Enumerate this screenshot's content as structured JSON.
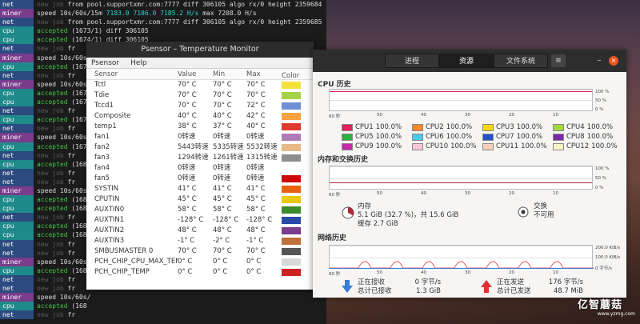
{
  "terminal": {
    "rows": [
      {
        "tag": "net",
        "parts": [
          [
            "new",
            "new job"
          ],
          [
            "txt",
            " from pool.supportxmr.com:7777 diff 306105 algo rx/0 height 2359684"
          ]
        ]
      },
      {
        "tag": "miner",
        "parts": [
          [
            "speed",
            "speed 10s/60s/15m "
          ],
          [
            "num",
            "7183.0 7186.0 7185.2 H/s"
          ],
          [
            "txt",
            " max 7208.0 H/s"
          ]
        ]
      },
      {
        "tag": "net",
        "parts": [
          [
            "new",
            "new job"
          ],
          [
            "txt",
            " from pool.supportxmr.com:7777 diff 306105 algo rx/0 height 2359685"
          ]
        ]
      },
      {
        "tag": "cpu",
        "parts": [
          [
            "acc",
            "accepted"
          ],
          [
            "txt",
            " (1673/1) diff 306105"
          ]
        ]
      },
      {
        "tag": "cpu",
        "parts": [
          [
            "acc",
            "accepted"
          ],
          [
            "txt",
            " (1674/1) diff 306105"
          ]
        ]
      },
      {
        "tag": "net",
        "parts": [
          [
            "new",
            "new job"
          ],
          [
            "txt",
            " fr"
          ]
        ]
      },
      {
        "tag": "miner",
        "parts": [
          [
            "speed",
            "speed 10s/60s/"
          ]
        ]
      },
      {
        "tag": "cpu",
        "parts": [
          [
            "acc",
            "accepted"
          ],
          [
            "txt",
            " (167"
          ]
        ]
      },
      {
        "tag": "net",
        "parts": [
          [
            "new",
            "new job"
          ],
          [
            "txt",
            " fr"
          ]
        ]
      },
      {
        "tag": "miner",
        "parts": [
          [
            "speed",
            "speed 10s/60s/"
          ]
        ]
      },
      {
        "tag": "cpu",
        "parts": [
          [
            "acc",
            "accepted"
          ],
          [
            "txt",
            " (167"
          ]
        ]
      },
      {
        "tag": "cpu",
        "parts": [
          [
            "acc",
            "accepted"
          ],
          [
            "txt",
            " (167"
          ]
        ]
      },
      {
        "tag": "net",
        "parts": [
          [
            "new",
            "new job"
          ],
          [
            "txt",
            " fr"
          ]
        ]
      },
      {
        "tag": "cpu",
        "parts": [
          [
            "acc",
            "accepted"
          ],
          [
            "txt",
            " (167"
          ]
        ]
      },
      {
        "tag": "net",
        "parts": [
          [
            "new",
            "new job"
          ],
          [
            "txt",
            " fr"
          ]
        ]
      },
      {
        "tag": "miner",
        "parts": [
          [
            "speed",
            "speed 10s/60s/"
          ]
        ]
      },
      {
        "tag": "cpu",
        "parts": [
          [
            "acc",
            "accepted"
          ],
          [
            "txt",
            " (167"
          ]
        ]
      },
      {
        "tag": "net",
        "parts": [
          [
            "new",
            "new job"
          ],
          [
            "txt",
            " fr"
          ]
        ]
      },
      {
        "tag": "cpu",
        "parts": [
          [
            "acc",
            "accepted"
          ],
          [
            "txt",
            " (168"
          ]
        ]
      },
      {
        "tag": "net",
        "parts": [
          [
            "new",
            "new job"
          ],
          [
            "txt",
            " fr"
          ]
        ]
      },
      {
        "tag": "net",
        "parts": [
          [
            "new",
            "new job"
          ],
          [
            "txt",
            " fr"
          ]
        ]
      },
      {
        "tag": "miner",
        "parts": [
          [
            "speed",
            "speed 10s/60s/"
          ]
        ]
      },
      {
        "tag": "cpu",
        "parts": [
          [
            "acc",
            "accepted"
          ],
          [
            "txt",
            " (168"
          ]
        ]
      },
      {
        "tag": "cpu",
        "parts": [
          [
            "acc",
            "accepted"
          ],
          [
            "txt",
            " (168"
          ]
        ]
      },
      {
        "tag": "net",
        "parts": [
          [
            "new",
            "new job"
          ],
          [
            "txt",
            " fr"
          ]
        ]
      },
      {
        "tag": "cpu",
        "parts": [
          [
            "acc",
            "accepted"
          ],
          [
            "txt",
            " (168"
          ]
        ]
      },
      {
        "tag": "cpu",
        "parts": [
          [
            "acc",
            "accepted"
          ],
          [
            "txt",
            " (168"
          ]
        ]
      },
      {
        "tag": "net",
        "parts": [
          [
            "new",
            "new job"
          ],
          [
            "txt",
            " fr"
          ]
        ]
      },
      {
        "tag": "net",
        "parts": [
          [
            "new",
            "new job"
          ],
          [
            "txt",
            " fr"
          ]
        ]
      },
      {
        "tag": "miner",
        "parts": [
          [
            "speed",
            "speed 10s/60s/"
          ]
        ]
      },
      {
        "tag": "cpu",
        "parts": [
          [
            "acc",
            "accepted"
          ],
          [
            "txt",
            " (168"
          ]
        ]
      },
      {
        "tag": "net",
        "parts": [
          [
            "new",
            "new job"
          ],
          [
            "txt",
            " fr"
          ]
        ]
      },
      {
        "tag": "net",
        "parts": [
          [
            "new",
            "new job"
          ],
          [
            "txt",
            " fr"
          ]
        ]
      },
      {
        "tag": "miner",
        "parts": [
          [
            "speed",
            "speed 10s/60s/"
          ]
        ]
      },
      {
        "tag": "cpu",
        "parts": [
          [
            "acc",
            "accepted"
          ],
          [
            "txt",
            " (168"
          ]
        ]
      },
      {
        "tag": "net",
        "parts": [
          [
            "new",
            "new job"
          ],
          [
            "txt",
            " fr"
          ]
        ]
      }
    ]
  },
  "psensor": {
    "title": "Psensor – Temperature Monitor",
    "menu": [
      "Psensor",
      "Help"
    ],
    "headers": {
      "sensor": "Sensor",
      "value": "Value",
      "min": "Min",
      "max": "Max",
      "color": "Color"
    },
    "rows": [
      {
        "name": "Tctl",
        "value": "70° C",
        "min": "70° C",
        "max": "70° C",
        "color": "#f5e13c",
        "checked": false
      },
      {
        "name": "Tdie",
        "value": "70° C",
        "min": "70° C",
        "max": "70° C",
        "color": "#a6d24a",
        "checked": false
      },
      {
        "name": "Tccd1",
        "value": "70° C",
        "min": "70° C",
        "max": "72° C",
        "color": "#6f8fd4",
        "checked": false
      },
      {
        "name": "Composite",
        "value": "40° C",
        "min": "40° C",
        "max": "42° C",
        "color": "#f7a340",
        "checked": false
      },
      {
        "name": "temp1",
        "value": "38° C",
        "min": "37° C",
        "max": "40° C",
        "color": "#e03a2e",
        "checked": false
      },
      {
        "name": "fan1",
        "value": "0转速",
        "min": "0转速",
        "max": "0转速",
        "color": "#b07ab8",
        "checked": false
      },
      {
        "name": "fan2",
        "value": "5443转速",
        "min": "5335转速",
        "max": "5532转速",
        "color": "#e8b888",
        "checked": false
      },
      {
        "name": "fan3",
        "value": "1294转速",
        "min": "1261转速",
        "max": "1315转速",
        "color": "#8e8e8e",
        "checked": false
      },
      {
        "name": "fan4",
        "value": "0转速",
        "min": "0转速",
        "max": "0转速",
        "color": "#ffffff",
        "checked": false
      },
      {
        "name": "fan5",
        "value": "0转速",
        "min": "0转速",
        "max": "0转速",
        "color": "#cc0a0a",
        "checked": false
      },
      {
        "name": "SYSTIN",
        "value": "41° C",
        "min": "41° C",
        "max": "41° C",
        "color": "#e8610e",
        "checked": false
      },
      {
        "name": "CPUTIN",
        "value": "45° C",
        "min": "45° C",
        "max": "45° C",
        "color": "#e8c810",
        "checked": false
      },
      {
        "name": "AUXTIN0",
        "value": "58° C",
        "min": "58° C",
        "max": "58° C",
        "color": "#3c8a2a",
        "checked": false
      },
      {
        "name": "AUXTIN1",
        "value": "-128° C",
        "min": "-128° C",
        "max": "-128° C",
        "color": "#2a4aa8",
        "checked": false
      },
      {
        "name": "AUXTIN2",
        "value": "48° C",
        "min": "48° C",
        "max": "48° C",
        "color": "#7a3c8c",
        "checked": false
      },
      {
        "name": "AUXTIN3",
        "value": "-1° C",
        "min": "-2° C",
        "max": "-1° C",
        "color": "#c0703a",
        "checked": false
      },
      {
        "name": "SMBUSMASTER 0",
        "value": "70° C",
        "min": "70° C",
        "max": "70° C",
        "color": "#555555",
        "checked": false
      },
      {
        "name": "PCH_CHIP_CPU_MAX_TEMP",
        "value": "0° C",
        "min": "0° C",
        "max": "0° C",
        "color": "#d8d8d8",
        "checked": false
      },
      {
        "name": "PCH_CHIP_TEMP",
        "value": "0° C",
        "min": "0° C",
        "max": "0° C",
        "color": "#cc2222",
        "checked": false
      }
    ]
  },
  "sysmon": {
    "tabs": [
      "进程",
      "资源",
      "文件系统"
    ],
    "active_tab": 1,
    "menu_icon": "hamburger-icon",
    "minimize": "–",
    "close": "×",
    "cpu": {
      "title": "CPU 历史",
      "y_top": "100 %",
      "y_mid": "50 %",
      "y_bottom": "0 %",
      "x_label": "60 秒",
      "x_ticks": [
        "50",
        "40",
        "30",
        "20",
        "10"
      ],
      "cores": [
        {
          "label": "CPU1",
          "value": "100.0%",
          "color": "#e5205a"
        },
        {
          "label": "CPU2",
          "value": "100.0%",
          "color": "#f7892a"
        },
        {
          "label": "CPU3",
          "value": "100.0%",
          "color": "#f5d90a"
        },
        {
          "label": "CPU4",
          "value": "100.0%",
          "color": "#a4d83a"
        },
        {
          "label": "CPU5",
          "value": "100.0%",
          "color": "#2cb040"
        },
        {
          "label": "CPU6",
          "value": "100.0%",
          "color": "#4ac8ea"
        },
        {
          "label": "CPU7",
          "value": "100.0%",
          "color": "#2a50c8"
        },
        {
          "label": "CPU8",
          "value": "100.0%",
          "color": "#7a2aa8"
        },
        {
          "label": "CPU9",
          "value": "100.0%",
          "color": "#c82aa8"
        },
        {
          "label": "CPU10",
          "value": "100.0%",
          "color": "#f8c8d8"
        },
        {
          "label": "CPU11",
          "value": "100.0%",
          "color": "#f8d0b8"
        },
        {
          "label": "CPU12",
          "value": "100.0%",
          "color": "#f8f0c8"
        }
      ]
    },
    "memory": {
      "title": "内存和交换历史",
      "y_top": "100 %",
      "y_mid": "50 %",
      "y_bottom": "0 %",
      "x_label": "60 秒",
      "x_ticks": [
        "50",
        "40",
        "30",
        "20",
        "10"
      ],
      "mem_label": "内存",
      "mem_line1": "5.1 GiB (32.7 %)，共 15.6 GiB",
      "mem_line2": "缓存 2.7 GiB",
      "mem_fraction": 0.327,
      "swap_label": "交换",
      "swap_value": "不可用",
      "line_color": "#b2243a"
    },
    "network": {
      "title": "网络历史",
      "y_top": "200.0 KiB/s",
      "y_mid": "100.0 KiB/s",
      "y_bottom": "0 字节/s",
      "x_label": "60 秒",
      "x_ticks": [
        "50",
        "40",
        "30",
        "20",
        "10"
      ],
      "recv_label": "正在接收",
      "recv_rate": "0 字节/s",
      "recv_total_label": "总计已接收",
      "recv_total": "1.3 GiB",
      "send_label": "正在发送",
      "send_rate": "176 字节/s",
      "send_total_label": "总计已发送",
      "send_total": "48.7 MiB",
      "recv_color": "#3a7ad8",
      "send_color": "#e03030"
    }
  },
  "watermark": {
    "text": "亿智蘑菇",
    "url": "www.yzmg.com"
  }
}
